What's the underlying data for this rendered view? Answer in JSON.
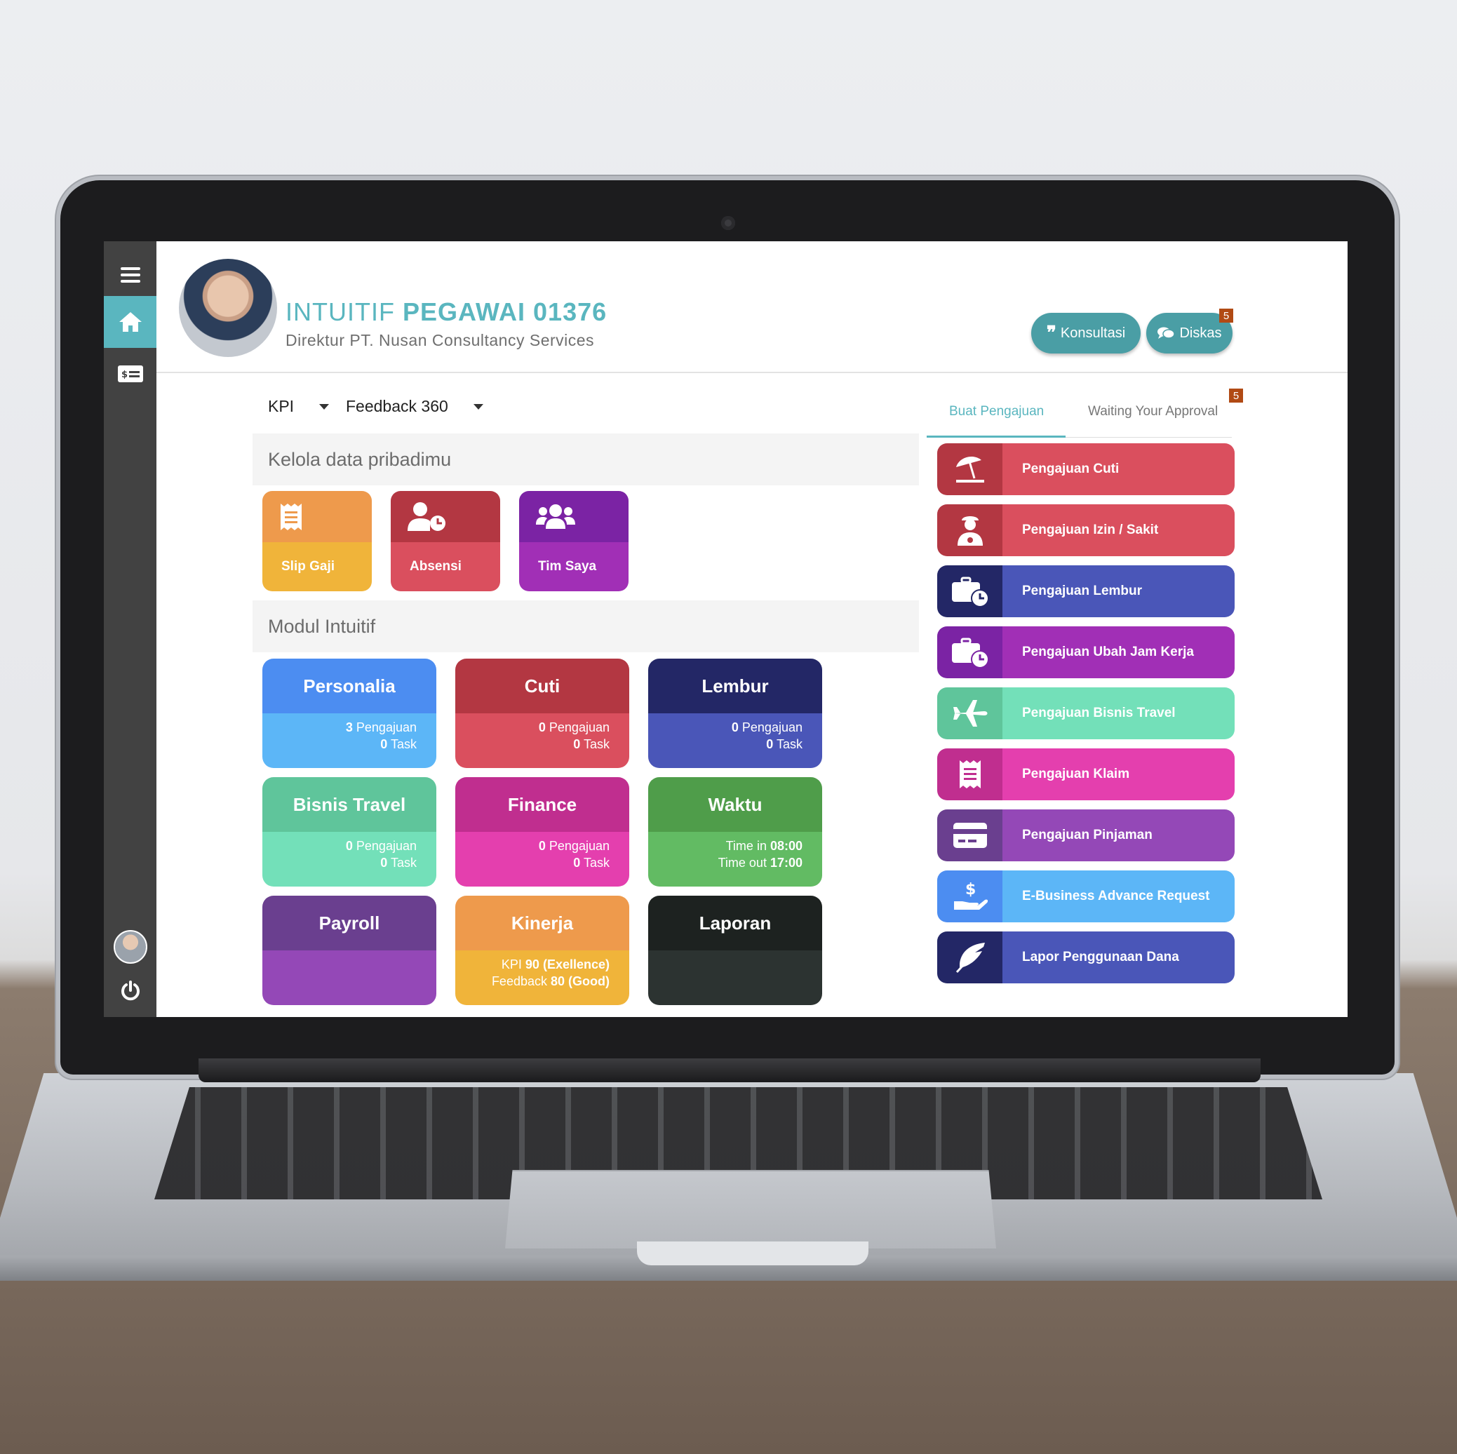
{
  "header": {
    "name_prefix": "INTUITIF",
    "name_bold": "PEGAWAI 01376",
    "subtitle": "Direktur PT. Nusan Consultancy Services",
    "konsultasi_label": "Konsultasi",
    "diskas_label": "Diskas",
    "diskas_badge": "5"
  },
  "filters": {
    "kpi_label": "KPI",
    "feedback_label": "Feedback 360"
  },
  "sections": {
    "kelola": "Kelola data pribadimu",
    "modul": "Modul Intuitif"
  },
  "quick_tiles": [
    {
      "label": "Slip Gaji",
      "icon": "receipt-icon",
      "top_color": "#ee9a4c",
      "bottom_color": "#f0b43a"
    },
    {
      "label": "Absensi",
      "icon": "user-clock-icon",
      "top_color": "#b33742",
      "bottom_color": "#da4f5e"
    },
    {
      "label": "Tim Saya",
      "icon": "users-icon",
      "top_color": "#7b23a4",
      "bottom_color": "#a12fb6"
    }
  ],
  "modules": [
    {
      "title": "Personalia",
      "line1_num": "3",
      "line1_text": " Pengajuan",
      "line2_num": "0",
      "line2_text": " Task",
      "top_color": "#4c8df1",
      "bottom_color": "#5cb6f7"
    },
    {
      "title": "Cuti",
      "line1_num": "0",
      "line1_text": " Pengajuan",
      "line2_num": "0",
      "line2_text": " Task",
      "top_color": "#b33742",
      "bottom_color": "#da4f5e"
    },
    {
      "title": "Lembur",
      "line1_num": "0",
      "line1_text": " Pengajuan",
      "line2_num": "0",
      "line2_text": " Task",
      "top_color": "#232766",
      "bottom_color": "#4a56b8"
    },
    {
      "title": "Bisnis Travel",
      "line1_num": "0",
      "line1_text": " Pengajuan",
      "line2_num": "0",
      "line2_text": " Task",
      "top_color": "#5fc59b",
      "bottom_color": "#73e0b9"
    },
    {
      "title": "Finance",
      "line1_num": "0",
      "line1_text": " Pengajuan",
      "line2_num": "0",
      "line2_text": " Task",
      "top_color": "#c02e8f",
      "bottom_color": "#e43fae"
    },
    {
      "title": "Waktu",
      "line1_text": "Time in ",
      "line1_num": "08:00",
      "line2_text": "Time out ",
      "line2_num": "17:00",
      "top_color": "#4f9d4a",
      "bottom_color": "#62bb63"
    },
    {
      "title": "Payroll",
      "top_color": "#6a3f8f",
      "bottom_color": "#9448b7"
    },
    {
      "title": "Kinerja",
      "line1_text": "KPI ",
      "line1_num": "90 (Exellence)",
      "line2_text": "Feedback ",
      "line2_num": "80 (Good)",
      "top_color": "#ee9a4c",
      "bottom_color": "#f0b43a"
    },
    {
      "title": "Laporan",
      "top_color": "#1d2220",
      "bottom_color": "#2c3331"
    }
  ],
  "tabs": {
    "buat": "Buat Pengajuan",
    "waiting": "Waiting Your Approval",
    "waiting_badge": "5"
  },
  "requests": [
    {
      "label": "Pengajuan Cuti",
      "icon": "beach-umbrella-icon",
      "icon_color": "#b33742",
      "color": "#da4f5e"
    },
    {
      "label": "Pengajuan Izin / Sakit",
      "icon": "sick-person-icon",
      "icon_color": "#b33742",
      "color": "#da4f5e"
    },
    {
      "label": "Pengajuan Lembur",
      "icon": "briefcase-clock-icon",
      "icon_color": "#232766",
      "color": "#4a56b8"
    },
    {
      "label": "Pengajuan Ubah Jam Kerja",
      "icon": "briefcase-clock-icon",
      "icon_color": "#7b23a4",
      "color": "#a12fb6"
    },
    {
      "label": "Pengajuan Bisnis Travel",
      "icon": "airplane-icon",
      "icon_color": "#5fc59b",
      "color": "#73e0b9"
    },
    {
      "label": "Pengajuan Klaim",
      "icon": "receipt-icon",
      "icon_color": "#c02e8f",
      "color": "#e43fae"
    },
    {
      "label": "Pengajuan Pinjaman",
      "icon": "credit-card-icon",
      "icon_color": "#6a3f8f",
      "color": "#9448b7"
    },
    {
      "label": "E-Business Advance Request",
      "icon": "hand-dollar-icon",
      "icon_color": "#4c8df1",
      "color": "#5cb6f7"
    },
    {
      "label": "Lapor Penggunaan Dana",
      "icon": "feather-icon",
      "icon_color": "#232766",
      "color": "#4a56b8"
    }
  ]
}
